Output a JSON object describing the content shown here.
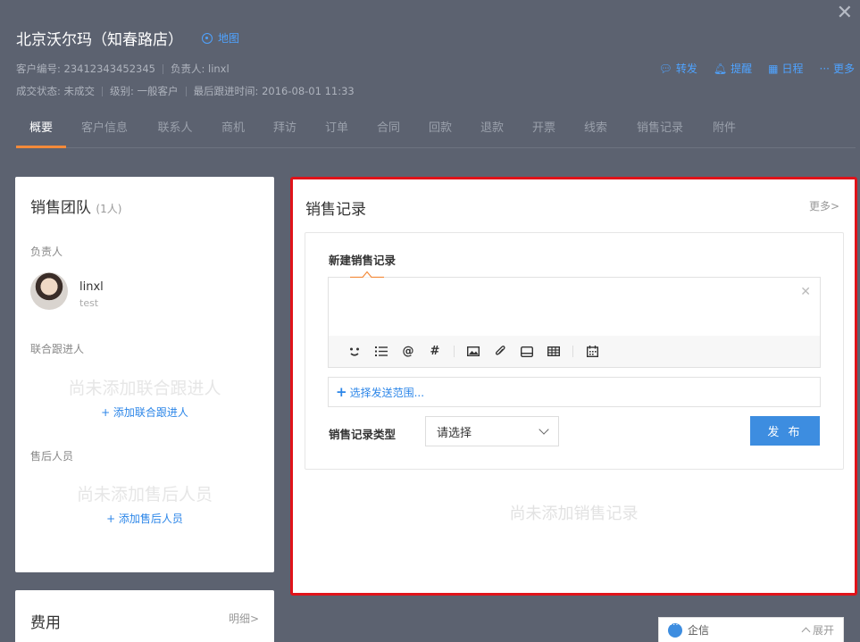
{
  "customer": {
    "title": "北京沃尔玛（知春路店）",
    "map_label": "地图",
    "meta_row1": [
      "客户编号: 23412343452345",
      "负责人: linxl"
    ],
    "meta_row2": [
      "成交状态: 未成交",
      "级别: 一般客户",
      "最后跟进时间: 2016-08-01 11:33"
    ]
  },
  "actions": [
    {
      "label": "转发",
      "icon": "chat-icon"
    },
    {
      "label": "提醒",
      "icon": "bell-icon"
    },
    {
      "label": "日程",
      "icon": "calendar-icon"
    },
    {
      "label": "更多",
      "icon": "more-icon"
    }
  ],
  "tabs": [
    {
      "label": "概要",
      "active": true
    },
    {
      "label": "客户信息"
    },
    {
      "label": "联系人"
    },
    {
      "label": "商机"
    },
    {
      "label": "拜访"
    },
    {
      "label": "订单"
    },
    {
      "label": "合同"
    },
    {
      "label": "回款"
    },
    {
      "label": "退款"
    },
    {
      "label": "开票"
    },
    {
      "label": "线索"
    },
    {
      "label": "销售记录"
    },
    {
      "label": "附件"
    }
  ],
  "team": {
    "title": "销售团队",
    "count": "(1人)",
    "owner_label": "负责人",
    "owner_name": "linxl",
    "owner_role": "test",
    "co_label": "联合跟进人",
    "co_empty": "尚未添加联合跟进人",
    "co_add": "+ 添加联合跟进人",
    "after_label": "售后人员",
    "after_empty": "尚未添加售后人员",
    "after_add": "+ 添加售后人员"
  },
  "cost": {
    "title": "费用",
    "detail": "明细>"
  },
  "sales": {
    "title": "销售记录",
    "more": "更多>",
    "new_title": "新建销售记录",
    "scope": "选择发送范围...",
    "type_label": "销售记录类型",
    "type_value": "请选择",
    "publish": "发 布",
    "empty": "尚未添加销售记录"
  },
  "toolbar_icons": [
    "emoji-icon",
    "list-icon",
    "mention-icon",
    "hashtag-icon",
    "image-icon",
    "attachment-icon",
    "storage-icon",
    "table-icon",
    "calendar-icon"
  ],
  "qixin": {
    "label": "企信",
    "expand": "展开"
  },
  "colors": {
    "accent": "#3d8de0",
    "link": "#2c86e8",
    "tab_active": "#f38a3a",
    "highlight": "#e0131a",
    "header_bg": "#5c6270"
  }
}
